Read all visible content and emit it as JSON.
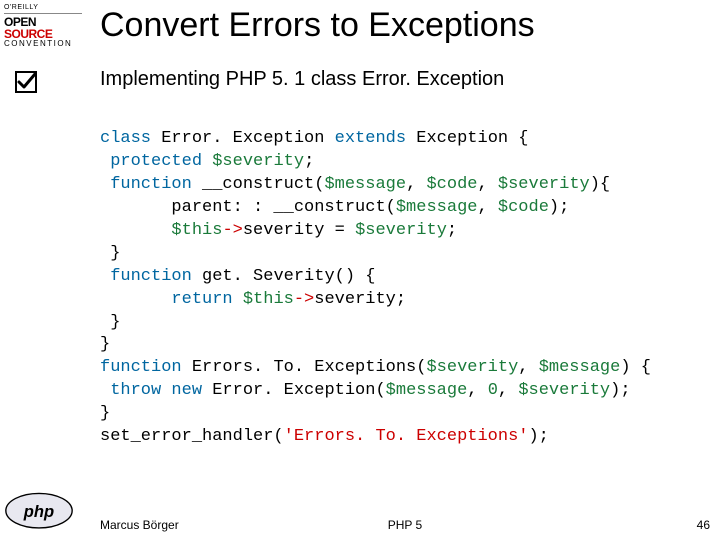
{
  "logo": {
    "top": "O'REILLY",
    "line1": "OPEN",
    "line2": "SOURCE",
    "line3": "CONVENTION"
  },
  "title": "Convert Errors to Exceptions",
  "subtitle": "Implementing PHP 5. 1 class Error. Exception",
  "code": {
    "tokens": [
      [
        "kw",
        "class"
      ],
      [
        "",
        " Error. Exception "
      ],
      [
        "kw",
        "extends"
      ],
      [
        "",
        " Exception {\n"
      ],
      [
        "",
        " "
      ],
      [
        "kw",
        "protected"
      ],
      [
        "",
        " "
      ],
      [
        "var",
        "$severity"
      ],
      [
        "",
        ";\n"
      ],
      [
        "",
        " "
      ],
      [
        "kw",
        "function"
      ],
      [
        "",
        " __construct("
      ],
      [
        "var",
        "$message"
      ],
      [
        "",
        ", "
      ],
      [
        "var",
        "$code"
      ],
      [
        "",
        ", "
      ],
      [
        "var",
        "$severity"
      ],
      [
        "",
        "){\n"
      ],
      [
        "",
        "       parent: : __construct("
      ],
      [
        "var",
        "$message"
      ],
      [
        "",
        ", "
      ],
      [
        "var",
        "$code"
      ],
      [
        "",
        ");\n"
      ],
      [
        "",
        "       "
      ],
      [
        "var",
        "$this"
      ],
      [
        "op",
        "->"
      ],
      [
        "",
        "severity "
      ],
      [
        "",
        "= "
      ],
      [
        "var",
        "$severity"
      ],
      [
        "",
        ";\n"
      ],
      [
        "",
        " }\n"
      ],
      [
        "",
        " "
      ],
      [
        "kw",
        "function"
      ],
      [
        "",
        " get. Severity() {\n"
      ],
      [
        "",
        "       "
      ],
      [
        "kw",
        "return"
      ],
      [
        "",
        " "
      ],
      [
        "var",
        "$this"
      ],
      [
        "op",
        "->"
      ],
      [
        "",
        "severity;\n"
      ],
      [
        "",
        " }\n"
      ],
      [
        "",
        "}\n"
      ],
      [
        "kw",
        "function"
      ],
      [
        "",
        " Errors. To. Exceptions("
      ],
      [
        "var",
        "$severity"
      ],
      [
        "",
        ", "
      ],
      [
        "var",
        "$message"
      ],
      [
        "",
        ") {\n"
      ],
      [
        "",
        " "
      ],
      [
        "kw",
        "throw new"
      ],
      [
        "",
        " Error. Exception("
      ],
      [
        "var",
        "$message"
      ],
      [
        "",
        ", "
      ],
      [
        "num",
        "0"
      ],
      [
        "",
        ", "
      ],
      [
        "var",
        "$severity"
      ],
      [
        "",
        ");\n"
      ],
      [
        "",
        "}\n"
      ],
      [
        "",
        "set_error_handler("
      ],
      [
        "str",
        "'Errors. To. Exceptions'"
      ],
      [
        "",
        ");"
      ]
    ]
  },
  "footer": {
    "author": "Marcus Börger",
    "center": "PHP 5",
    "page": "46"
  }
}
